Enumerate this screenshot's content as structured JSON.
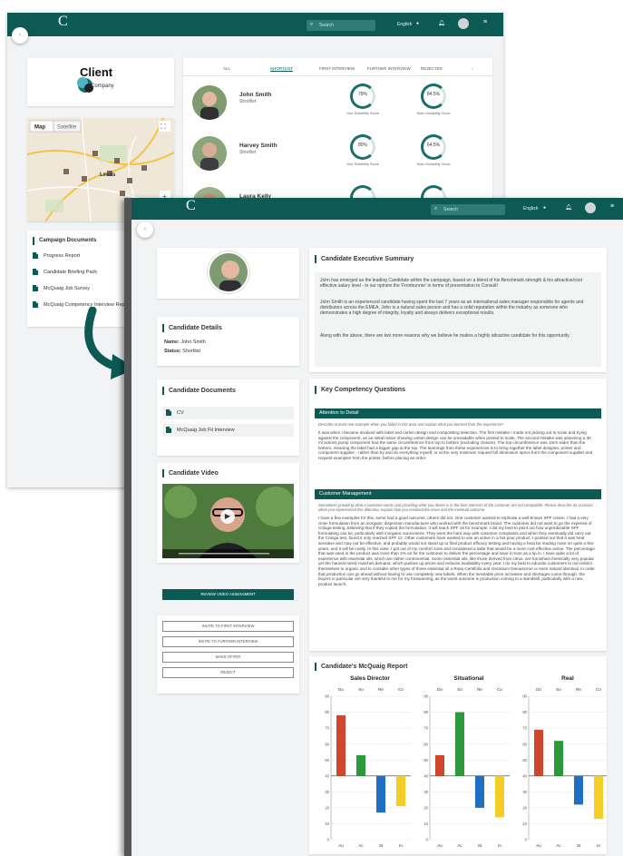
{
  "colors": {
    "brand": "#0d5a55",
    "accent": "#1a6e67",
    "red": "#d0472e",
    "green": "#2a9a3b",
    "blue": "#1f6fc4",
    "yellow": "#f5cd25"
  },
  "back": {
    "header": {
      "search_placeholder": "Search",
      "language": "English"
    },
    "client_logo": {
      "line1": "Client",
      "line2": "Company"
    },
    "map": {
      "map_btn": "Map",
      "satellite_btn": "Satellite",
      "city": "Leeds"
    },
    "tabs": [
      "ALL",
      "SHORTLIST",
      "FIRST INTERVIEW",
      "FURTHER INTERVIEW",
      "REJECTED"
    ],
    "candidates": [
      {
        "name": "John Smith",
        "status": "Shortlist",
        "score1": "79%",
        "score1_label": "Your Suitability Score",
        "score2": "84.5%",
        "score2_label": "Team Suitability Score"
      },
      {
        "name": "Harvey Smith",
        "status": "Shortlist",
        "score1": "80%",
        "score1_label": "Your Suitability Score",
        "score2": "64.5%",
        "score2_label": "Team Suitability Score"
      },
      {
        "name": "Laura Kelly",
        "status": "Shortlist",
        "score1": "",
        "score2": ""
      }
    ],
    "campaign_docs": {
      "title": "Campaign Documents",
      "items": [
        "Progress Report",
        "Candidate Briefing Pack",
        "McQuaig Job Survey",
        "McQuaig Competency Interview Report"
      ]
    }
  },
  "front": {
    "header": {
      "search_placeholder": "Search",
      "language": "English"
    },
    "details": {
      "title": "Candidate Details",
      "name_label": "Name:",
      "name": "John Smith",
      "status_label": "Status:",
      "status": "Shortlist"
    },
    "documents": {
      "title": "Candidate Documents",
      "items": [
        "CV",
        "McQuaig Job Fit Interview"
      ]
    },
    "video": {
      "title": "Candidate Video"
    },
    "buttons": {
      "review": "REVIEW VIDEO ASSESSMENT",
      "invite_first": "INVITE TO FIRST INTERVIEW",
      "invite_further": "INVITE TO FURTHER INTERVIEW",
      "offer": "MAKE OFFER",
      "reject": "REJECT"
    },
    "summary": {
      "title": "Candidate Executive Summary",
      "p1": "John has emerged as the leading Candidate within the campaign, based on a blend of his Benchmark strength & his attractive/cost effective salary level - in our opinion the 'Frontrunner' in terms of presentation to Consult!",
      "p2": "John Smith is an experienced candidate having spent the last 7 years as an international sales manager responsible for agents and distributors across the EMEA. John is a natural sales person and has a solid reputation within the industry as someone who demonstrates a high degree of integrity, loyalty and always delivers exceptional results.",
      "p3": "Along with the above, there are two more reasons why we believe he makes a highly attractive candidate for this opportunity."
    },
    "competency": {
      "title": "Key Competency Questions",
      "s1_title": "Attention to Detail",
      "s1_q": "Describe at least one example when you failed in this area and explain what you learned from the experience?",
      "s1_a": "It was when I became involved with label and carton design and compositing selection. The first mistake I made not picking out to scale and trying against the component, as an initial notice showing carton design can be unreadable when printed to scale. The second mistake was assuming a 30 ml actions pump component had the same circumference from top to bottom (excluding closure). The top circumference was 1mm wider than the bottom, meaning the label had a bigger gap at the top. The learnings from these experiences is to bring together the label designer, printer and component supplier - rather than try and do everything myself, or at the very minimum request full dimension specs from the component supplier and request examples from the printer, before placing an order.",
      "s2_title": "Customer Management",
      "s2_q": "Sometimes providing what a customer wants and providing what you desire is in the best interests of the customer are not compatible. Please describe an occasion when you experienced this dilemma, explain how you resolved the issue and the eventual outcome.",
      "s2_a": "I have a few examples for this, some had a good outcome, others did not. One customer wanted to replicate a well-known SPF cream. I had a very close formulation from an inorganic dispersion manufacturer who worked with the benchmark brand. The customer did not want to go the expense of Cologa testing, believing that if they copied the formulation, it will reach SPF 15 for example. I did my best to point out how unpredictable SPF formulating can be, particularly with inorganic sunscreens. They went the hard way with customer complaints and when they eventually did carry out the Cologa test, found it only reached SPF 12. Other customers have wanted to use an active in a hot pour product. I pointed out that it was heat sensitive and may not be effective, and probably would not stand up to final product efficacy testing and having a heat be reading more on quite a few years, and it will be costly. In this case, I got out of my comfort zone and considered a tailor that would be a more cost effective active. The percentage that was used in the product was more than 2% on for the customer to deliver the percentage and save it more as a tip in. I have quite a lot of experience with essential oils, which are rather controversial. Some essential oils, like those derived from citrus, are furnished chemically very popular yet the harvest rarely matches demand, which pushes up prices and reduces availability every year. I do my best to educate customers to not restrict themselves to organic and to consider other types of those essential oil a Rosa Centifolia and Geranium Damascene or even natural identical, in order that production can go ahead without having to use completely new labels. When the inevitable price increases and shortages came through, the buyers in particular are very thankful to me for my forewarning, as the worst outcome is production coming to a standstill, particularly with a new product launch."
    },
    "report": {
      "title": "Candidate's McQuaig Report"
    }
  },
  "chart_data": [
    {
      "type": "bar",
      "title": "Sales Director",
      "categories": [
        "Do",
        "So",
        "Re",
        "Co"
      ],
      "bottom_labels": [
        "Au",
        "Ac",
        "St",
        "In"
      ],
      "values": [
        78,
        53,
        17,
        21
      ],
      "ylim": [
        0,
        90
      ],
      "yticks": [
        0,
        10,
        20,
        30,
        40,
        50,
        60,
        70,
        80,
        90
      ],
      "baseline": 40,
      "colors": [
        "#d0472e",
        "#2a9a3b",
        "#1f6fc4",
        "#f5cd25"
      ]
    },
    {
      "type": "bar",
      "title": "Situational",
      "categories": [
        "Do",
        "So",
        "Re",
        "Co"
      ],
      "bottom_labels": [
        "Au",
        "Ac",
        "St",
        "In"
      ],
      "values": [
        53,
        80,
        20,
        14
      ],
      "ylim": [
        0,
        90
      ],
      "yticks": [
        0,
        10,
        20,
        30,
        40,
        50,
        60,
        70,
        80,
        90
      ],
      "baseline": 40,
      "colors": [
        "#d0472e",
        "#2a9a3b",
        "#1f6fc4",
        "#f5cd25"
      ]
    },
    {
      "type": "bar",
      "title": "Real",
      "categories": [
        "Do",
        "So",
        "Re",
        "Co"
      ],
      "bottom_labels": [
        "Au",
        "Ac",
        "St",
        "In"
      ],
      "values": [
        69,
        62,
        22,
        13
      ],
      "ylim": [
        0,
        90
      ],
      "yticks": [
        0,
        10,
        20,
        30,
        40,
        50,
        60,
        70,
        80,
        90
      ],
      "baseline": 40,
      "colors": [
        "#d0472e",
        "#2a9a3b",
        "#1f6fc4",
        "#f5cd25"
      ]
    }
  ]
}
